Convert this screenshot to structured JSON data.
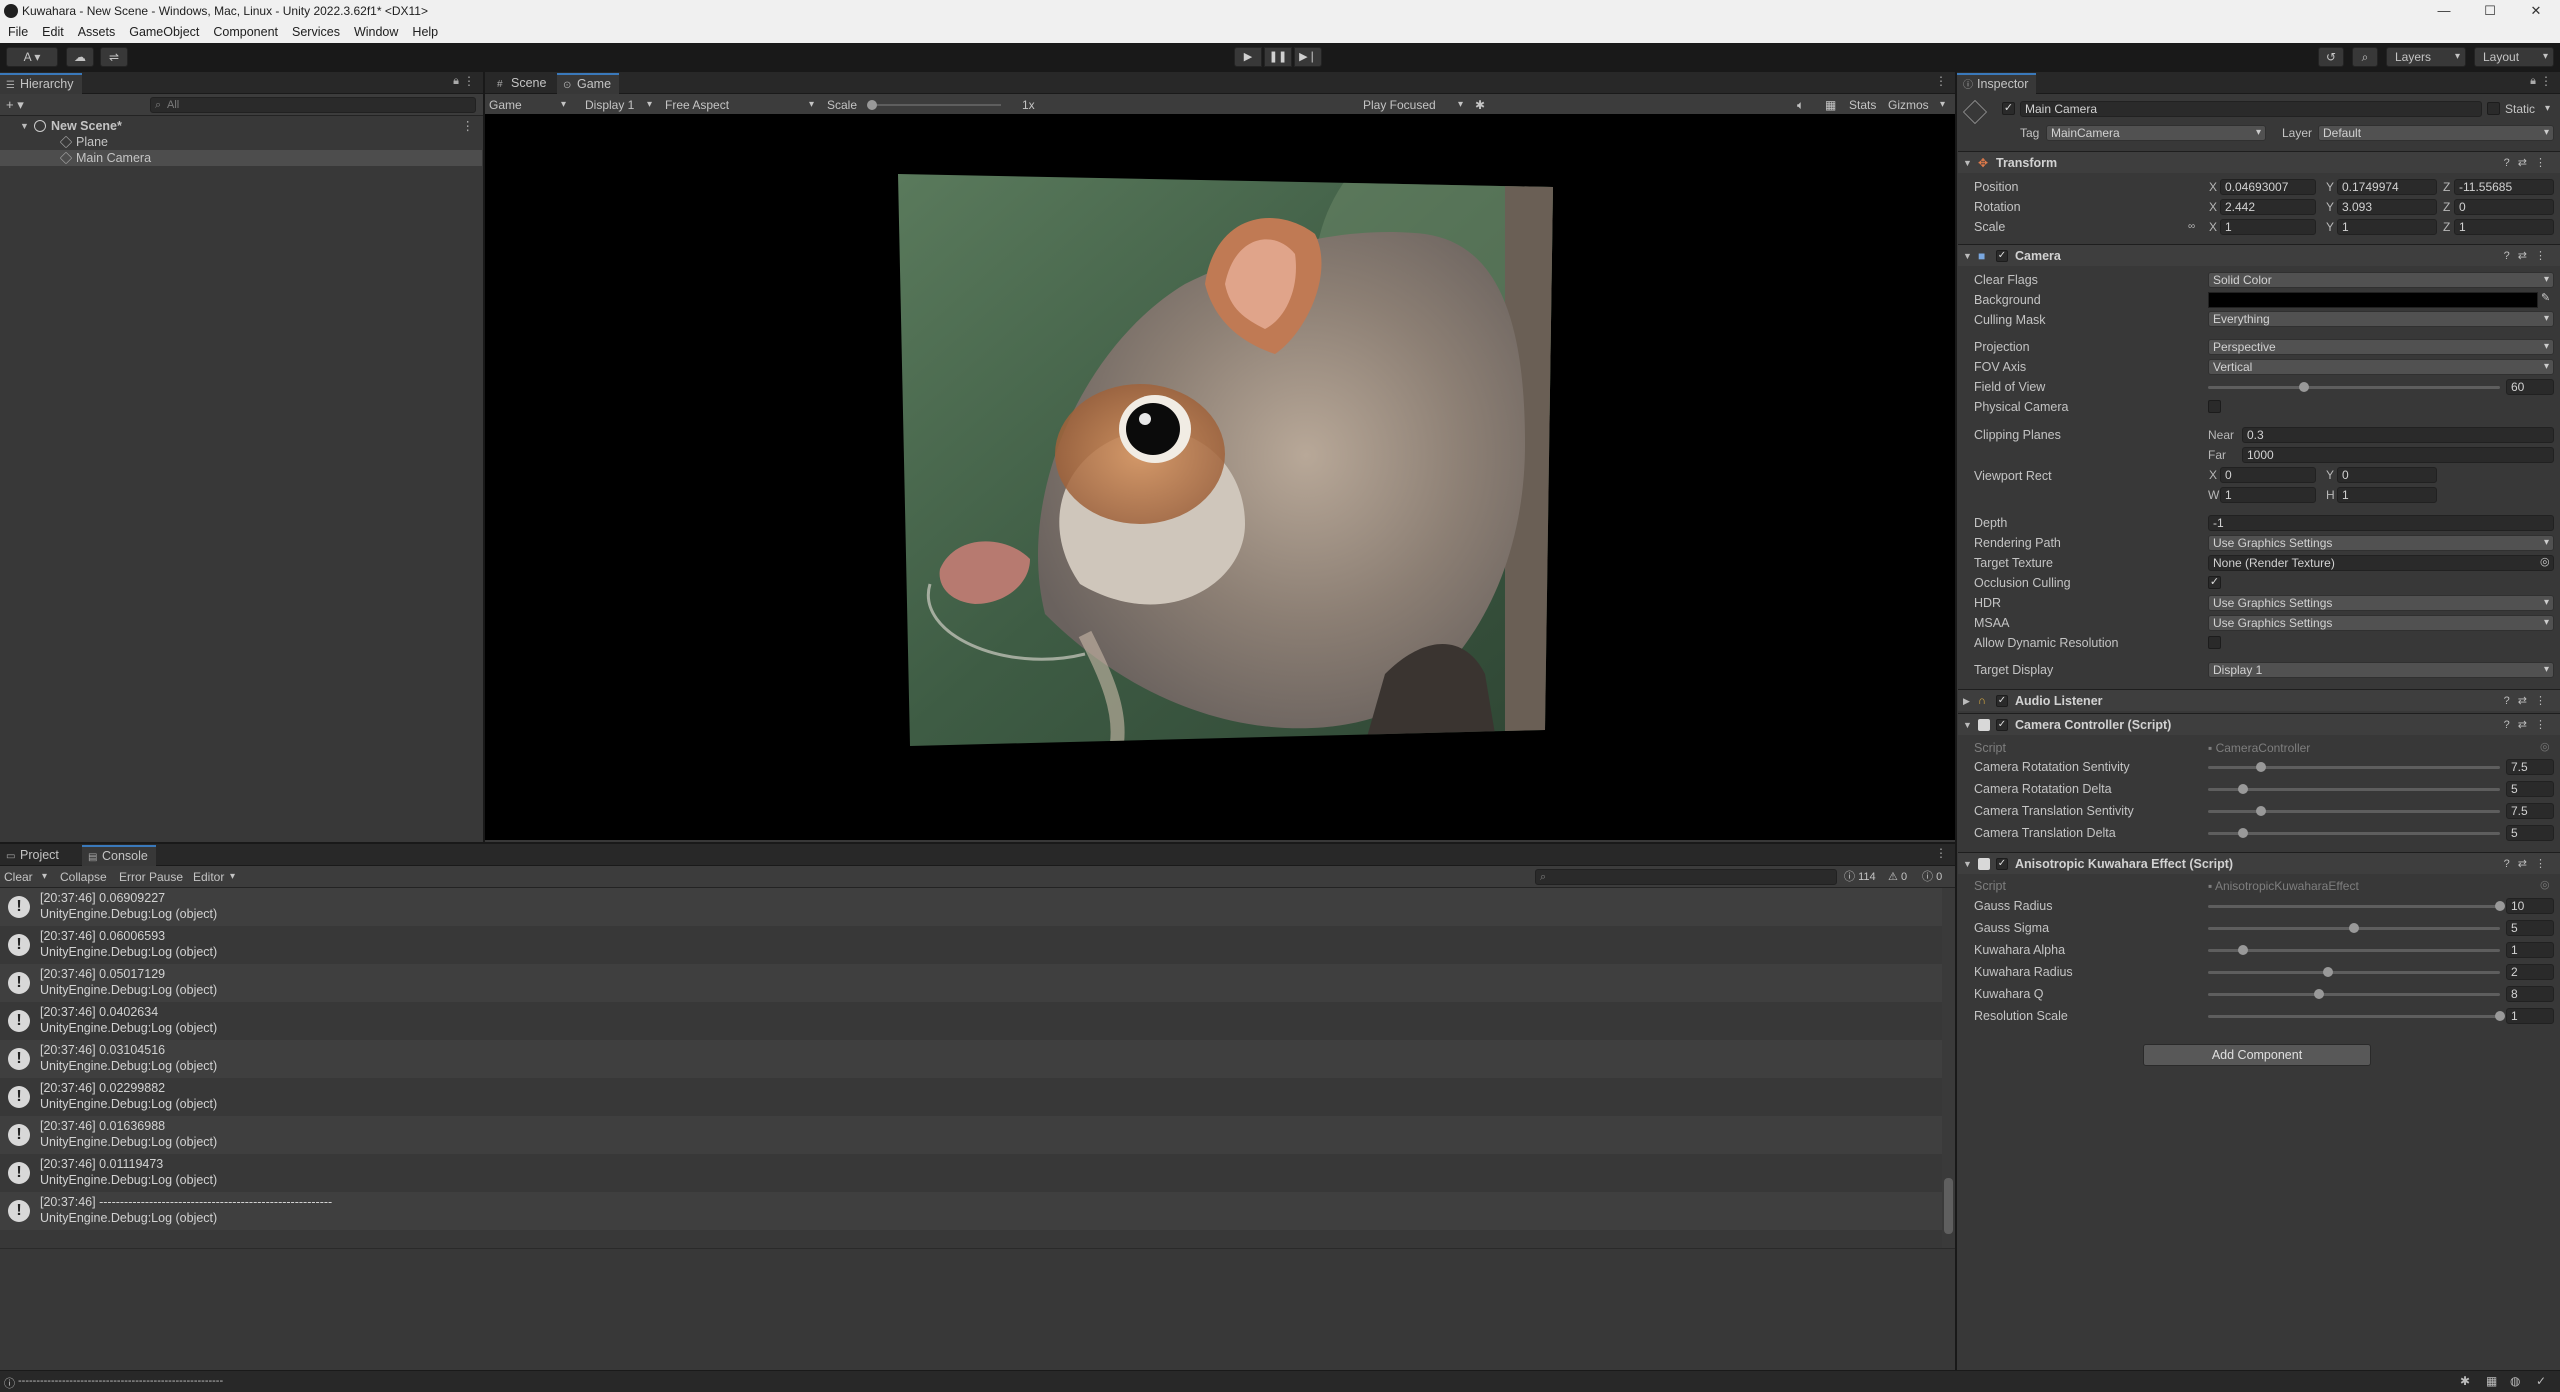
{
  "window": {
    "title": "Kuwahara - New Scene - Windows, Mac, Linux - Unity 2022.3.62f1* <DX11>",
    "minimize": "—",
    "maximize": "☐",
    "close": "✕"
  },
  "menu": [
    "File",
    "Edit",
    "Assets",
    "GameObject",
    "Component",
    "Services",
    "Window",
    "Help"
  ],
  "toolbar": {
    "account": "A ▾",
    "cloud": "☁",
    "collab": "⇌",
    "play": "▶",
    "pause": "❚❚",
    "step": "▶❘",
    "history": "↺",
    "search": "⌕",
    "layers": "Layers",
    "layout": "Layout"
  },
  "hierarchy": {
    "tab": "Hierarchy",
    "add": "+ ▾",
    "search_placeholder": "All",
    "rows": [
      {
        "label": "New Scene*",
        "depth": 0,
        "bold": true,
        "expanded": true
      },
      {
        "label": "Plane",
        "depth": 1,
        "bold": false
      },
      {
        "label": "Main Camera",
        "depth": 1,
        "bold": false,
        "selected": true
      }
    ]
  },
  "gameview": {
    "tabs": [
      "Scene",
      "Game"
    ],
    "active_tab": "Game",
    "mode": "Game",
    "display": "Display 1",
    "aspect": "Free Aspect",
    "scale_label": "Scale",
    "scale_value": "1x",
    "play_focused": "Play Focused",
    "stats": "Stats",
    "gizmos": "Gizmos"
  },
  "console": {
    "tabs": [
      "Project",
      "Console"
    ],
    "active_tab": "Console",
    "clear": "Clear",
    "collapse": "Collapse",
    "error_pause": "Error Pause",
    "editor": "Editor",
    "count_log": "114",
    "count_warn": "0",
    "count_err": "0",
    "entries": [
      {
        "line1": "[20:37:46] 0.06909227",
        "line2": "UnityEngine.Debug:Log (object)"
      },
      {
        "line1": "[20:37:46] 0.06006593",
        "line2": "UnityEngine.Debug:Log (object)"
      },
      {
        "line1": "[20:37:46] 0.05017129",
        "line2": "UnityEngine.Debug:Log (object)"
      },
      {
        "line1": "[20:37:46] 0.0402634",
        "line2": "UnityEngine.Debug:Log (object)"
      },
      {
        "line1": "[20:37:46] 0.03104516",
        "line2": "UnityEngine.Debug:Log (object)"
      },
      {
        "line1": "[20:37:46] 0.02299882",
        "line2": "UnityEngine.Debug:Log (object)"
      },
      {
        "line1": "[20:37:46] 0.01636988",
        "line2": "UnityEngine.Debug:Log (object)"
      },
      {
        "line1": "[20:37:46] 0.01119473",
        "line2": "UnityEngine.Debug:Log (object)"
      },
      {
        "line1": "[20:37:46] --------------------------------------------------------",
        "line2": "UnityEngine.Debug:Log (object)"
      }
    ]
  },
  "statusbar": {
    "text": "--------------------------------------------------------"
  },
  "inspector": {
    "tab": "Inspector",
    "object_name": "Main Camera",
    "static_label": "Static",
    "tag_label": "Tag",
    "tag_value": "MainCamera",
    "layer_label": "Layer",
    "layer_value": "Default",
    "transform": {
      "title": "Transform",
      "position_label": "Position",
      "rotation_label": "Rotation",
      "scale_label": "Scale",
      "position": {
        "x": "0.04693007",
        "y": "0.1749974",
        "z": "-11.55685"
      },
      "rotation": {
        "x": "2.442",
        "y": "3.093",
        "z": "0"
      },
      "scale": {
        "x": "1",
        "y": "1",
        "z": "1"
      }
    },
    "camera": {
      "title": "Camera",
      "clear_flags_label": "Clear Flags",
      "clear_flags": "Solid Color",
      "background_label": "Background",
      "culling_mask_label": "Culling Mask",
      "culling_mask": "Everything",
      "projection_label": "Projection",
      "projection": "Perspective",
      "fov_axis_label": "FOV Axis",
      "fov_axis": "Vertical",
      "fov_label": "Field of View",
      "fov": "60",
      "fov_fraction": 0.33,
      "physical_label": "Physical Camera",
      "clipping_label": "Clipping Planes",
      "near_label": "Near",
      "near": "0.3",
      "far_label": "Far",
      "far": "1000",
      "viewport_label": "Viewport Rect",
      "vx": "0",
      "vy": "0",
      "vw": "1",
      "vh": "1",
      "depth_label": "Depth",
      "depth": "-1",
      "rendering_label": "Rendering Path",
      "rendering": "Use Graphics Settings",
      "target_texture_label": "Target Texture",
      "target_texture": "None (Render Texture)",
      "occlusion_label": "Occlusion Culling",
      "hdr_label": "HDR",
      "hdr": "Use Graphics Settings",
      "msaa_label": "MSAA",
      "msaa": "Use Graphics Settings",
      "dynres_label": "Allow Dynamic Resolution",
      "target_display_label": "Target Display",
      "target_display": "Display 1"
    },
    "audio_listener": {
      "title": "Audio Listener"
    },
    "camera_controller": {
      "title": "Camera Controller (Script)",
      "script_label": "Script",
      "script": "CameraController",
      "fields": [
        {
          "label": "Camera Rotatation Sentivity",
          "value": "7.5",
          "fraction": 0.18
        },
        {
          "label": "Camera Rotatation Delta",
          "value": "5",
          "fraction": 0.12
        },
        {
          "label": "Camera Translation Sentivity",
          "value": "7.5",
          "fraction": 0.18
        },
        {
          "label": "Camera Translation Delta",
          "value": "5",
          "fraction": 0.12
        }
      ]
    },
    "kuwahara": {
      "title": "Anisotropic Kuwahara Effect (Script)",
      "script_label": "Script",
      "script": "AnisotropicKuwaharaEffect",
      "fields": [
        {
          "label": "Gauss Radius",
          "value": "10",
          "fraction": 1.0
        },
        {
          "label": "Gauss Sigma",
          "value": "5",
          "fraction": 0.5
        },
        {
          "label": "Kuwahara Alpha",
          "value": "1",
          "fraction": 0.12
        },
        {
          "label": "Kuwahara Radius",
          "value": "2",
          "fraction": 0.41
        },
        {
          "label": "Kuwahara Q",
          "value": "8",
          "fraction": 0.38
        },
        {
          "label": "Resolution Scale",
          "value": "1",
          "fraction": 1.0
        }
      ]
    },
    "add_component": "Add Component"
  },
  "colors": {
    "accent": "#3a79bb",
    "panel": "#383838",
    "background": "#191919"
  }
}
